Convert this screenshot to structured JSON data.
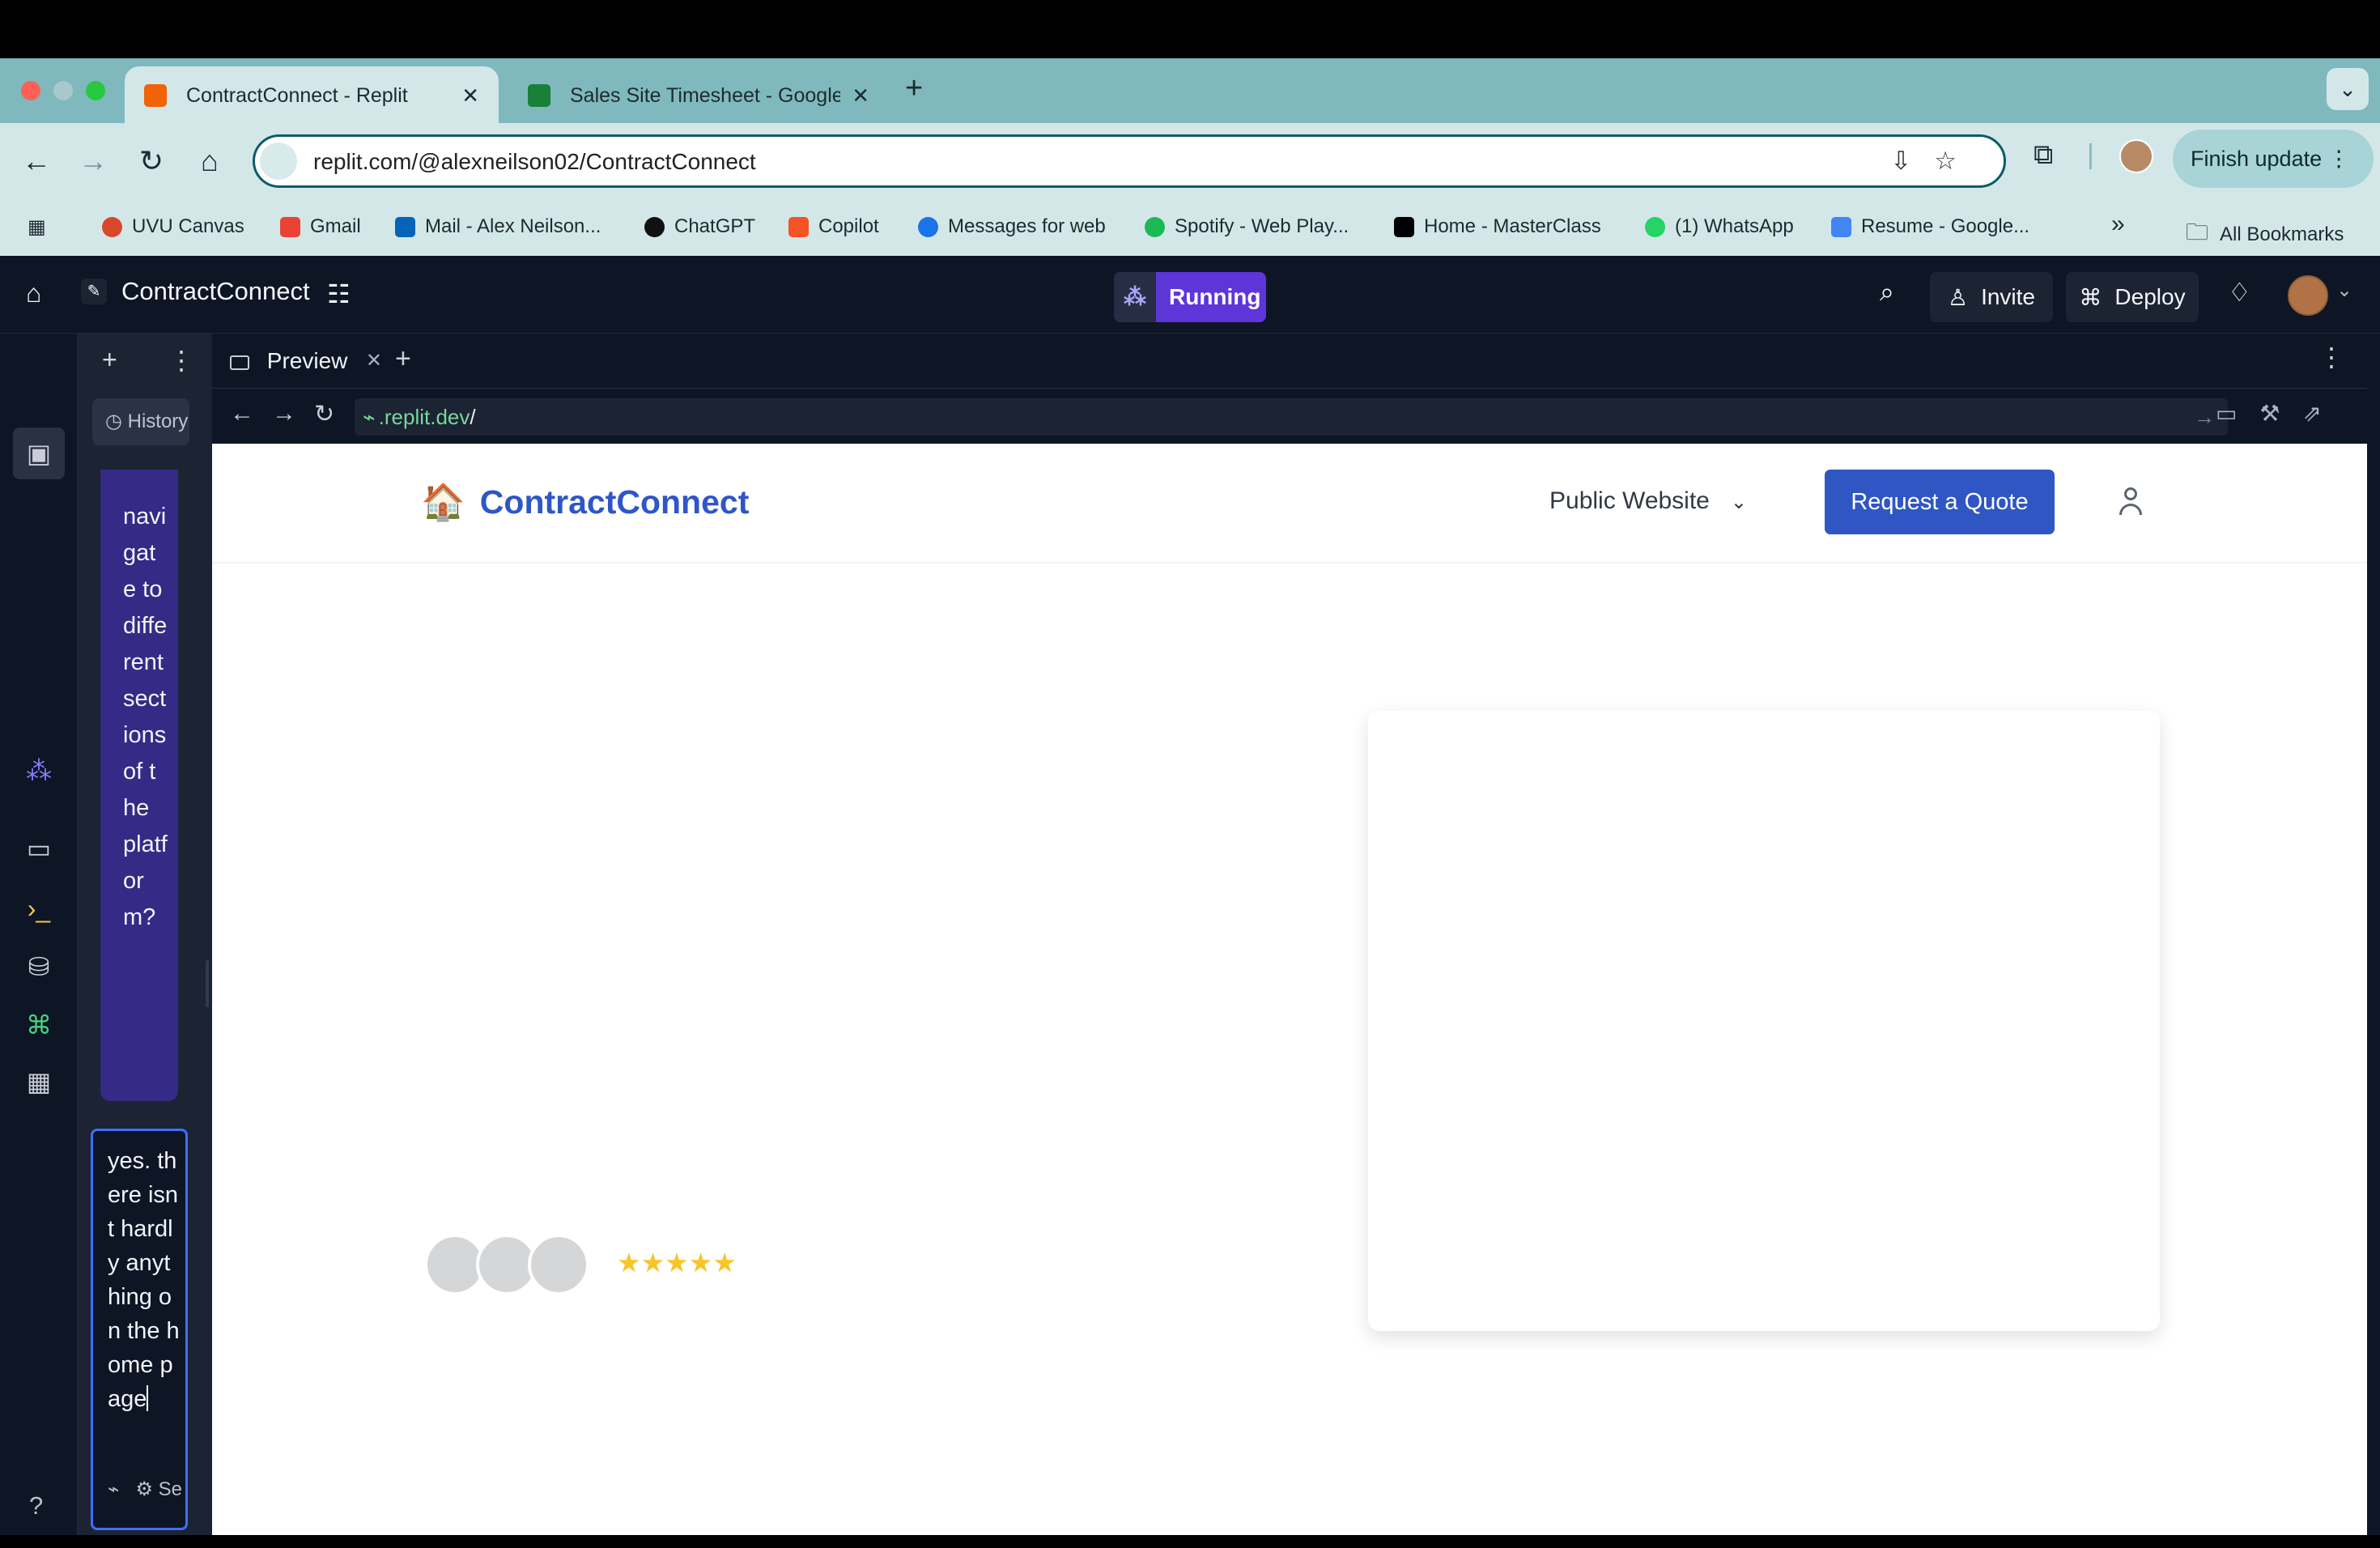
{
  "browser": {
    "tabs": [
      {
        "title": "ContractConnect - Replit",
        "favicon_color": "#f26207"
      },
      {
        "title": "Sales Site Timesheet - Google",
        "favicon_color": "#188038"
      }
    ],
    "url": "replit.com/@alexneilson02/ContractConnect",
    "finish_update": "Finish update",
    "bookmarks": [
      {
        "label": "UVU Canvas",
        "icon_color": "#d9472b"
      },
      {
        "label": "Gmail",
        "icon_color": "#ea4335"
      },
      {
        "label": "Mail - Alex Neilson...",
        "icon_color": "#0364b8"
      },
      {
        "label": "ChatGPT",
        "icon_color": "#111111"
      },
      {
        "label": "Copilot",
        "icon_color": "#f35325"
      },
      {
        "label": "Messages for web",
        "icon_color": "#1a73e8"
      },
      {
        "label": "Spotify - Web Play...",
        "icon_color": "#1db954"
      },
      {
        "label": "Home - MasterClass",
        "icon_color": "#000000"
      },
      {
        "label": "(1) WhatsApp",
        "icon_color": "#25d366"
      },
      {
        "label": "Resume - Google...",
        "icon_color": "#4285f4"
      }
    ],
    "more_bookmarks": "»",
    "all_bookmarks": "All Bookmarks"
  },
  "replit": {
    "project_name": "ContractConnect",
    "running_label": "Running",
    "invite_label": "Invite",
    "deploy_label": "Deploy",
    "history_label": "History",
    "chat_message": "navigate to different sections of the platform?",
    "input_text": "yes. there isnt hardly anything on the home page",
    "preview_tab": "Preview",
    "preview_url_domain": ".replit.dev",
    "preview_url_path": "/",
    "tool_settings_label": "Se"
  },
  "website": {
    "brand": "ContractConnect",
    "brand_icon": "🏠",
    "dropdown_label": "Public Website",
    "cta_label": "Request a Quote",
    "rating_stars": 5,
    "stars_text": "★★★★★"
  }
}
